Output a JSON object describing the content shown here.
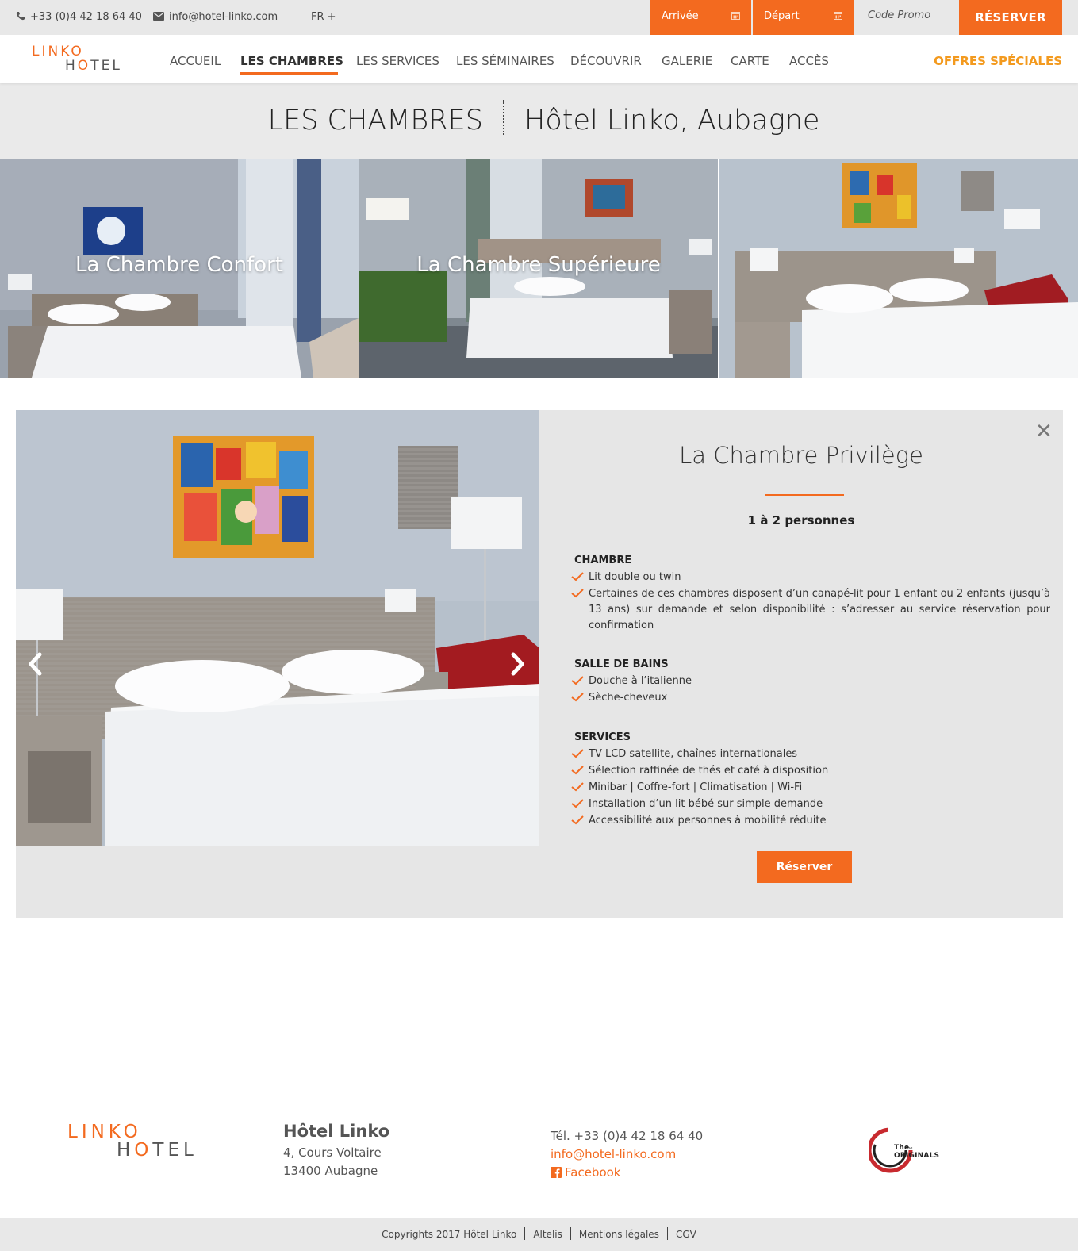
{
  "topbar": {
    "phone": "+33 (0)4 42 18 64 40",
    "email": "info@hotel-linko.com",
    "language": "FR +",
    "arrival_label": "Arrivée",
    "departure_label": "Départ",
    "promo_placeholder": "Code Promo",
    "reserve_label": "RÉSERVER"
  },
  "logo": {
    "line1": "LINKO",
    "line2_h": "H",
    "line2_o": "O",
    "line2_rest": "TEL"
  },
  "nav": {
    "items": [
      "ACCUEIL",
      "LES CHAMBRES",
      "LES SERVICES",
      "LES SÉMINAIRES",
      "DÉCOUVRIR",
      "GALERIE",
      "CARTE",
      "ACCÈS"
    ],
    "active": "LES CHAMBRES",
    "offers": "OFFRES SPÉCIALES"
  },
  "page_header": {
    "title_left": "LES CHAMBRES",
    "title_right": "Hôtel Linko, Aubagne"
  },
  "rooms": [
    {
      "caption": "La Chambre Confort"
    },
    {
      "caption": "La Chambre Supérieure"
    },
    {
      "caption": ""
    }
  ],
  "detail": {
    "title": "La Chambre Privilège",
    "capacity": "1 à 2 personnes",
    "sections": [
      {
        "heading": "CHAMBRE",
        "items": [
          "Lit double ou twin",
          "Certaines de ces chambres disposent d’un canapé-lit pour 1 enfant ou 2 enfants (jusqu’à 13 ans) sur demande et selon disponibilité : s’adresser au service réservation pour confirmation"
        ]
      },
      {
        "heading": "SALLE DE BAINS",
        "items": [
          "Douche à l’italienne",
          "Sèche-cheveux"
        ]
      },
      {
        "heading": "SERVICES",
        "items": [
          "TV LCD satellite, chaînes internationales",
          "Sélection raffinée de thés et café à disposition",
          "Minibar | Coffre-fort | Climatisation | Wi-Fi",
          "Installation d’un lit bébé sur simple demande",
          "Accessibilité aux personnes à mobilité réduite"
        ]
      }
    ],
    "button_label": "Réserver",
    "close_icon": "close-icon"
  },
  "footer": {
    "hotel_name": "Hôtel Linko",
    "address_line1": "4, Cours Voltaire",
    "address_line2": "13400 Aubagne",
    "tel": "Tél. +33 (0)4 42 18 64 40",
    "email": "info@hotel-linko.com",
    "facebook": "Facebook",
    "partner_logo_text": "The ORIGINALS",
    "bottom_links": [
      "Copyrights 2017 Hôtel Linko",
      "Altelis",
      "Mentions légales",
      "CGV"
    ]
  },
  "colors": {
    "accent": "#f36a1f",
    "offers": "#f39a1f",
    "band": "#eaeaea",
    "panel": "#e6e6e6"
  }
}
